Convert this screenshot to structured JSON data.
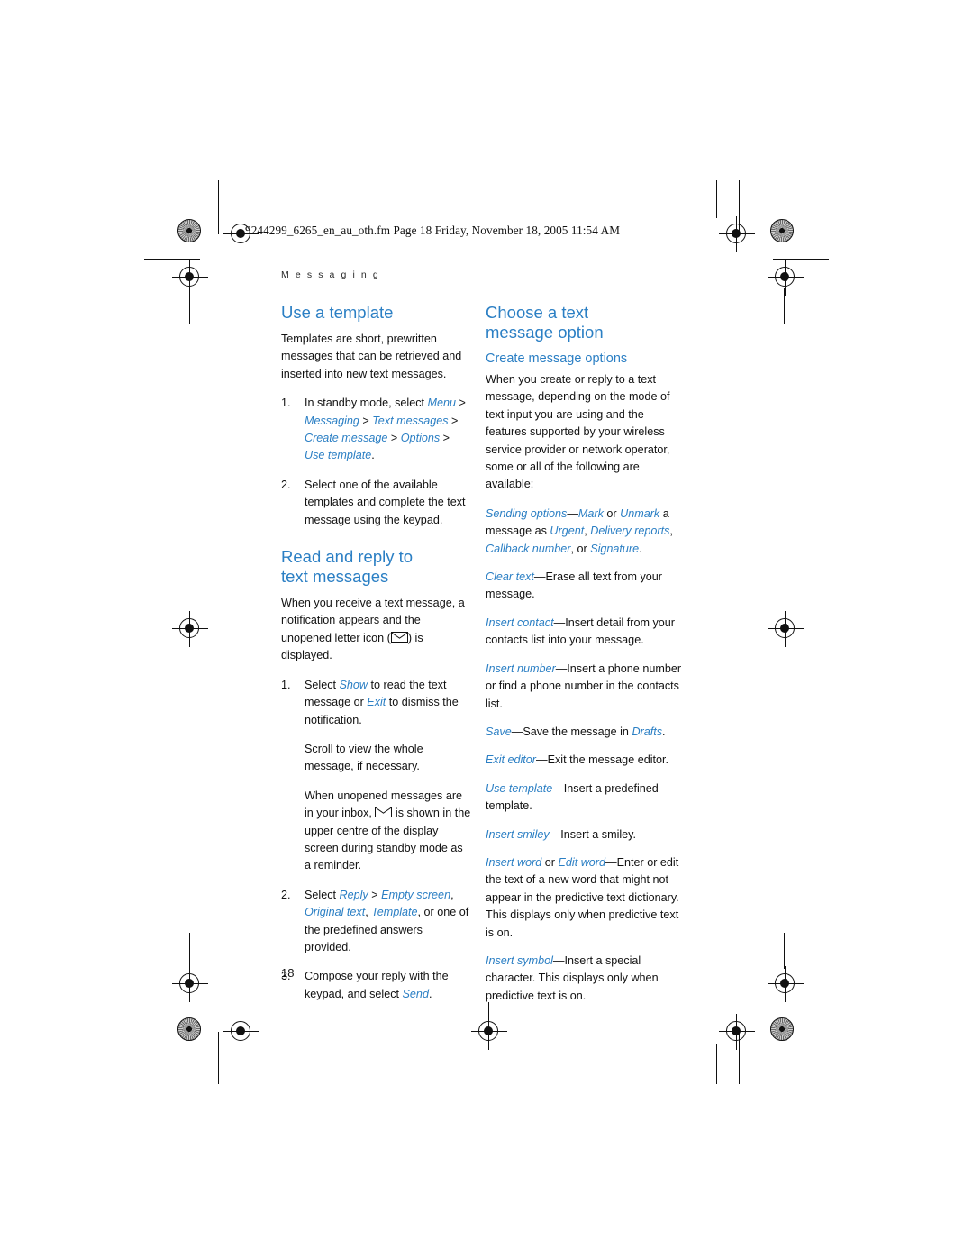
{
  "print_meta": {
    "filename_line": "9244299_6265_en_au_oth.fm  Page 18  Friday, November 18, 2005  11:54 AM"
  },
  "running_head": "M e s s a g i n g",
  "page_number": "18",
  "accent_color": "#2b7fc4",
  "left_column": {
    "section_1": {
      "heading": "Use a template",
      "intro": "Templates are short, prewritten messages that can be retrieved and inserted into new text messages.",
      "steps": [
        {
          "num": "1.",
          "parts": [
            {
              "text": "In standby mode, select ",
              "style": "plain"
            },
            {
              "text": "Menu",
              "style": "blue-italic"
            },
            {
              "text": " > ",
              "style": "plain"
            },
            {
              "text": "Messaging",
              "style": "blue-italic"
            },
            {
              "text": " > ",
              "style": "plain"
            },
            {
              "text": "Text messages",
              "style": "blue-italic"
            },
            {
              "text": " > ",
              "style": "plain"
            },
            {
              "text": "Create message",
              "style": "blue-italic"
            },
            {
              "text": " > ",
              "style": "plain"
            },
            {
              "text": "Options",
              "style": "blue-italic"
            },
            {
              "text": " > ",
              "style": "plain"
            },
            {
              "text": "Use template",
              "style": "blue-italic"
            },
            {
              "text": ".",
              "style": "plain"
            }
          ]
        },
        {
          "num": "2.",
          "parts": [
            {
              "text": "Select one of the available templates and complete the text message using the keypad.",
              "style": "plain"
            }
          ]
        }
      ]
    },
    "section_2": {
      "heading": "Read and reply to text messages",
      "intro_a": "When you receive a text message, a notification appears and the unopened letter icon (",
      "intro_icon": "envelope-icon",
      "intro_b": ") is displayed.",
      "steps": [
        {
          "num": "1.",
          "parts": [
            {
              "text": "Select ",
              "style": "plain"
            },
            {
              "text": "Show",
              "style": "blue-italic"
            },
            {
              "text": " to read the text message or ",
              "style": "plain"
            },
            {
              "text": "Exit",
              "style": "blue-italic"
            },
            {
              "text": " to dismiss the notification.",
              "style": "plain"
            }
          ],
          "extra_paragraphs": [
            "Scroll to view the whole message, if necessary."
          ],
          "extra_with_icon": {
            "before": "When unopened messages are in your inbox, ",
            "icon": "envelope-icon",
            "after": " is shown in the upper centre of the display screen during standby mode as a reminder."
          }
        },
        {
          "num": "2.",
          "parts": [
            {
              "text": "Select ",
              "style": "plain"
            },
            {
              "text": "Reply",
              "style": "blue-italic"
            },
            {
              "text": " > ",
              "style": "plain"
            },
            {
              "text": "Empty screen",
              "style": "blue-italic"
            },
            {
              "text": ", ",
              "style": "plain"
            },
            {
              "text": "Original text",
              "style": "blue-italic"
            },
            {
              "text": ", ",
              "style": "plain"
            },
            {
              "text": "Template",
              "style": "blue-italic"
            },
            {
              "text": ", or one of the predefined answers provided.",
              "style": "plain"
            }
          ]
        },
        {
          "num": "3.",
          "parts": [
            {
              "text": "Compose your reply with the keypad, and select ",
              "style": "plain"
            },
            {
              "text": "Send",
              "style": "blue-italic"
            },
            {
              "text": ".",
              "style": "plain"
            }
          ]
        }
      ]
    }
  },
  "right_column": {
    "heading": "Choose a text message option",
    "subheading": "Create message options",
    "intro": "When you create or reply to a text message, depending on the mode of text input you are using and the features supported by your wireless service provider or network operator, some or all of the following are available:",
    "options": [
      {
        "parts": [
          {
            "text": "Sending options",
            "style": "blue-italic"
          },
          {
            "text": "—",
            "style": "plain"
          },
          {
            "text": "Mark",
            "style": "blue-italic"
          },
          {
            "text": " or ",
            "style": "plain"
          },
          {
            "text": "Unmark",
            "style": "blue-italic"
          },
          {
            "text": " a message as ",
            "style": "plain"
          },
          {
            "text": "Urgent",
            "style": "blue-italic"
          },
          {
            "text": ", ",
            "style": "plain"
          },
          {
            "text": "Delivery reports",
            "style": "blue-italic"
          },
          {
            "text": ", ",
            "style": "plain"
          },
          {
            "text": "Callback number",
            "style": "blue-italic"
          },
          {
            "text": ", or ",
            "style": "plain"
          },
          {
            "text": "Signature",
            "style": "blue-italic"
          },
          {
            "text": ".",
            "style": "plain"
          }
        ]
      },
      {
        "parts": [
          {
            "text": "Clear text",
            "style": "blue-italic"
          },
          {
            "text": "—Erase all text from your message.",
            "style": "plain"
          }
        ]
      },
      {
        "parts": [
          {
            "text": "Insert contact",
            "style": "blue-italic"
          },
          {
            "text": "—Insert detail from your contacts list into your message.",
            "style": "plain"
          }
        ]
      },
      {
        "parts": [
          {
            "text": "Insert number",
            "style": "blue-italic"
          },
          {
            "text": "—Insert a phone number or find a phone number in the contacts list.",
            "style": "plain"
          }
        ]
      },
      {
        "parts": [
          {
            "text": "Save",
            "style": "blue-italic"
          },
          {
            "text": "—Save the message in ",
            "style": "plain"
          },
          {
            "text": "Drafts",
            "style": "blue-italic"
          },
          {
            "text": ".",
            "style": "plain"
          }
        ]
      },
      {
        "parts": [
          {
            "text": "Exit editor",
            "style": "blue-italic"
          },
          {
            "text": "—Exit the message editor.",
            "style": "plain"
          }
        ]
      },
      {
        "parts": [
          {
            "text": "Use template",
            "style": "blue-italic"
          },
          {
            "text": "—Insert a predefined template.",
            "style": "plain"
          }
        ]
      },
      {
        "parts": [
          {
            "text": "Insert smiley",
            "style": "blue-italic"
          },
          {
            "text": "—Insert a smiley.",
            "style": "plain"
          }
        ]
      },
      {
        "parts": [
          {
            "text": "Insert word",
            "style": "blue-italic"
          },
          {
            "text": " or ",
            "style": "plain"
          },
          {
            "text": "Edit word",
            "style": "blue-italic"
          },
          {
            "text": "—Enter or edit the text of a new word that might not appear in the predictive text dictionary. This displays only when predictive text is on.",
            "style": "plain"
          }
        ]
      },
      {
        "parts": [
          {
            "text": "Insert symbol",
            "style": "blue-italic"
          },
          {
            "text": "—Insert a special character. This displays only when predictive text is on.",
            "style": "plain"
          }
        ]
      }
    ]
  }
}
